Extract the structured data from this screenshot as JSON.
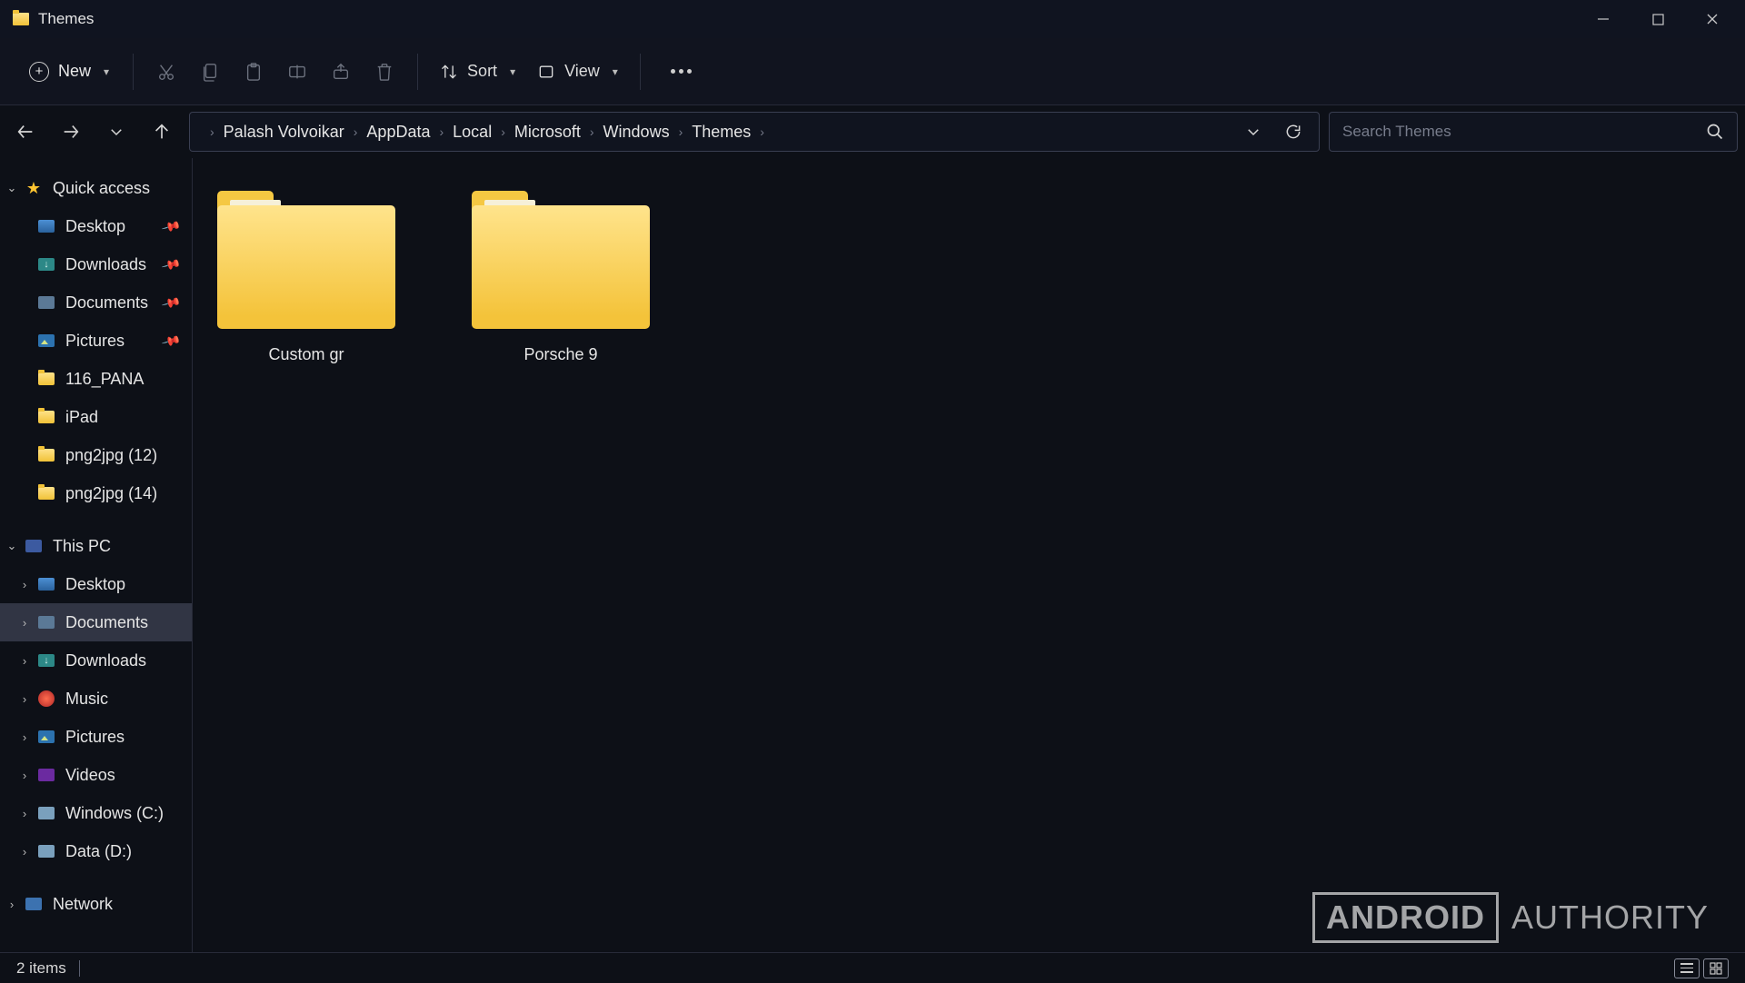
{
  "window": {
    "title": "Themes"
  },
  "toolbar": {
    "new_label": "New",
    "sort_label": "Sort",
    "view_label": "View"
  },
  "breadcrumbs": [
    "Palash Volvoikar",
    "AppData",
    "Local",
    "Microsoft",
    "Windows",
    "Themes"
  ],
  "search": {
    "placeholder": "Search Themes"
  },
  "sidebar": {
    "quick_access": {
      "label": "Quick access",
      "items": [
        {
          "label": "Desktop",
          "icon": "sq-blue",
          "pinned": true
        },
        {
          "label": "Downloads",
          "icon": "sq-green",
          "pinned": true
        },
        {
          "label": "Documents",
          "icon": "sq-doc",
          "pinned": true
        },
        {
          "label": "Pictures",
          "icon": "sq-pic",
          "pinned": true
        },
        {
          "label": "116_PANA",
          "icon": "sq-folder",
          "pinned": false
        },
        {
          "label": "iPad",
          "icon": "sq-folder",
          "pinned": false
        },
        {
          "label": "png2jpg (12)",
          "icon": "sq-folder",
          "pinned": false
        },
        {
          "label": "png2jpg (14)",
          "icon": "sq-folder",
          "pinned": false
        }
      ]
    },
    "this_pc": {
      "label": "This PC",
      "items": [
        {
          "label": "Desktop",
          "icon": "sq-blue"
        },
        {
          "label": "Documents",
          "icon": "sq-doc",
          "selected": true
        },
        {
          "label": "Downloads",
          "icon": "sq-green"
        },
        {
          "label": "Music",
          "icon": "sq-music"
        },
        {
          "label": "Pictures",
          "icon": "sq-pic"
        },
        {
          "label": "Videos",
          "icon": "sq-video"
        },
        {
          "label": "Windows (C:)",
          "icon": "sq-drive"
        },
        {
          "label": "Data (D:)",
          "icon": "sq-drive"
        }
      ]
    },
    "network": {
      "label": "Network"
    }
  },
  "items": [
    {
      "label": "Custom gr"
    },
    {
      "label": "Porsche 9"
    }
  ],
  "status": {
    "text": "2 items"
  },
  "watermark": {
    "brand_boxed": "ANDROID",
    "brand_light": "AUTHORITY"
  }
}
